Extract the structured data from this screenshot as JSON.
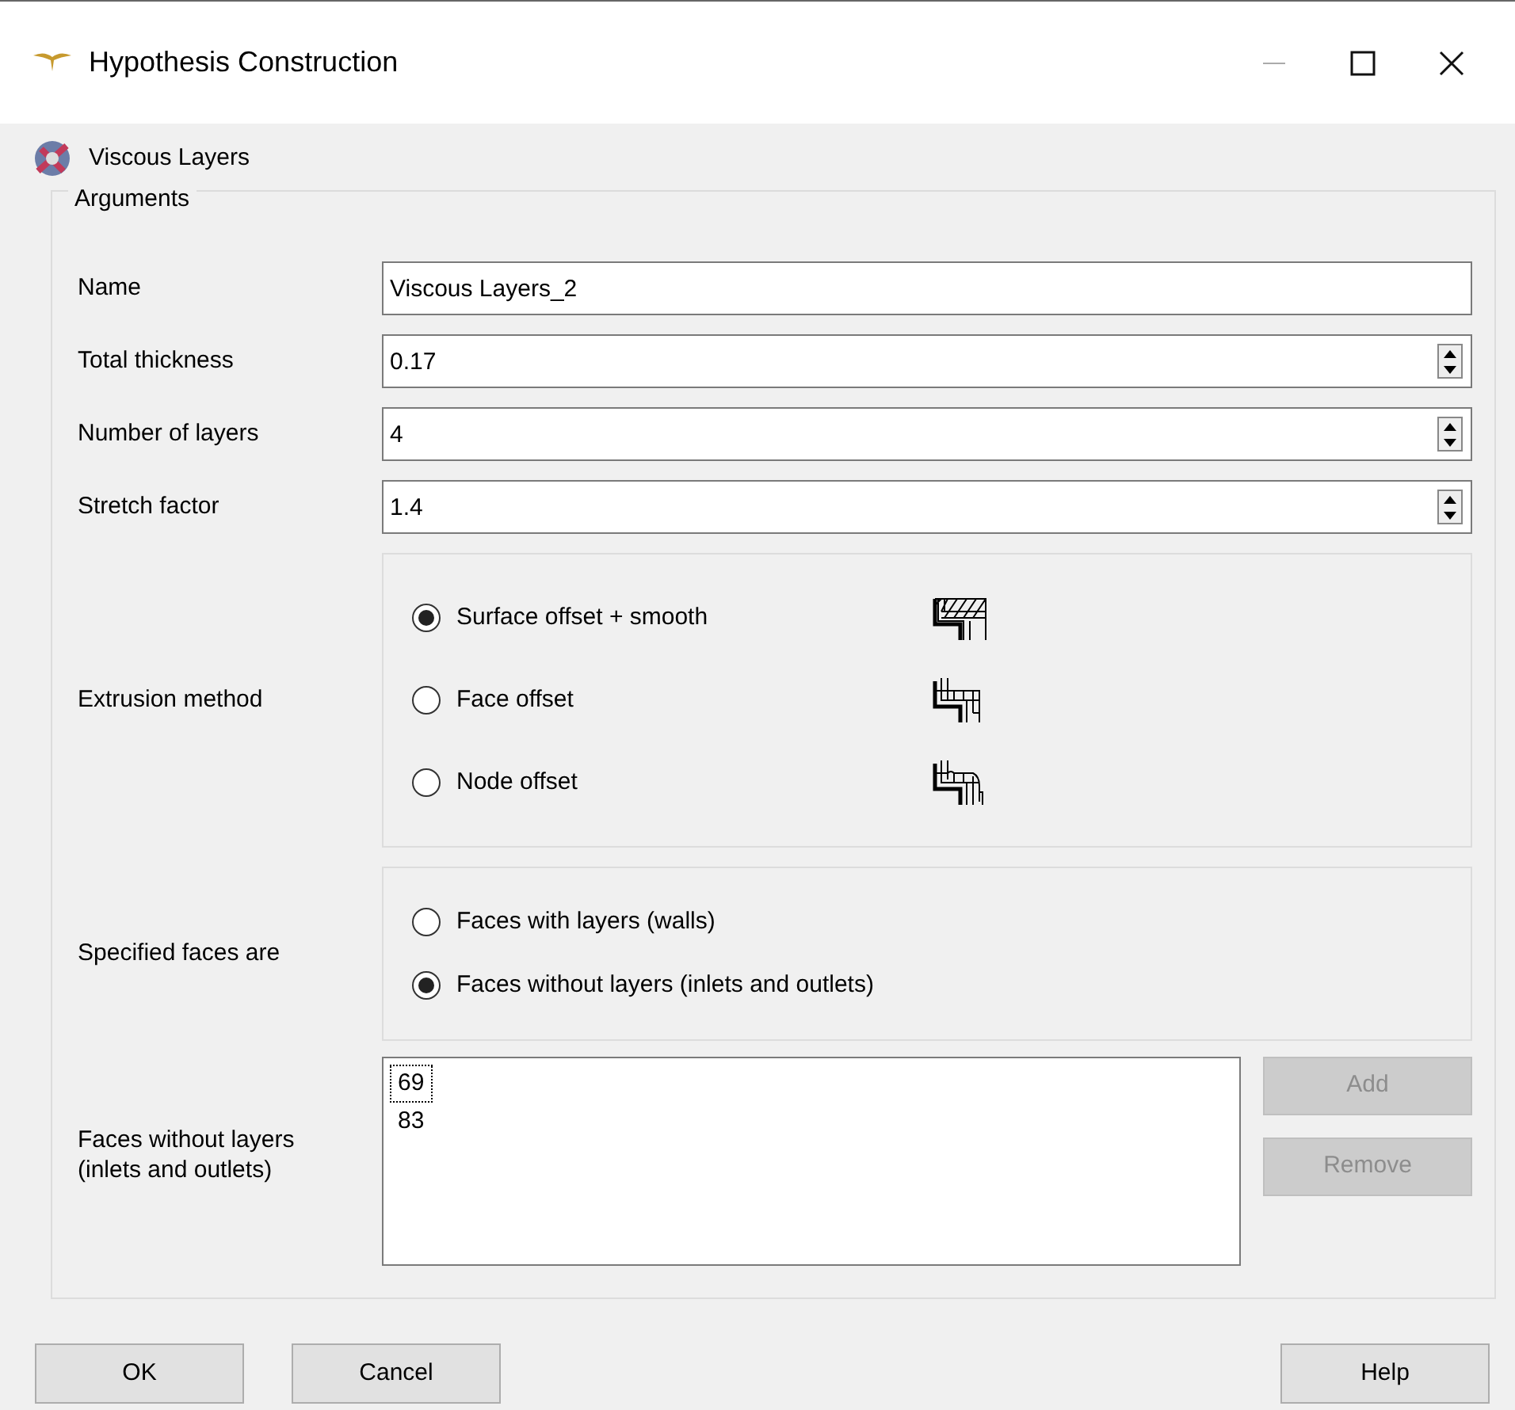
{
  "window": {
    "title": "Hypothesis Construction"
  },
  "hypothesis": {
    "title": "Viscous Layers"
  },
  "arguments": {
    "title": "Arguments",
    "fields": [
      {
        "label": "Name",
        "value": "Viscous Layers_2",
        "kind": "text"
      },
      {
        "label": "Total thickness",
        "value": "0.17",
        "kind": "spin"
      },
      {
        "label": "Number of layers",
        "value": "4",
        "kind": "spin"
      },
      {
        "label": "Stretch factor",
        "value": "1.4",
        "kind": "spin"
      }
    ],
    "extrusion_method": {
      "label": "Extrusion method",
      "options": [
        {
          "label": "Surface offset + smooth",
          "selected": true
        },
        {
          "label": "Face offset",
          "selected": false
        },
        {
          "label": "Node offset",
          "selected": false
        }
      ]
    },
    "specified_faces": {
      "label": "Specified faces are",
      "options": [
        {
          "label": "Faces with layers (walls)",
          "selected": false
        },
        {
          "label": "Faces without layers (inlets and outlets)",
          "selected": true
        }
      ]
    },
    "faces": {
      "label": "Faces without layers\n(inlets and outlets)",
      "items": [
        {
          "text": "69",
          "focused": true
        },
        {
          "text": "83",
          "focused": false
        }
      ],
      "buttons": [
        {
          "label": "Add",
          "disabled": true
        },
        {
          "label": "Remove",
          "disabled": true
        }
      ]
    }
  },
  "buttons": {
    "left": [
      "OK",
      "Cancel"
    ],
    "right": [
      "Help"
    ]
  }
}
